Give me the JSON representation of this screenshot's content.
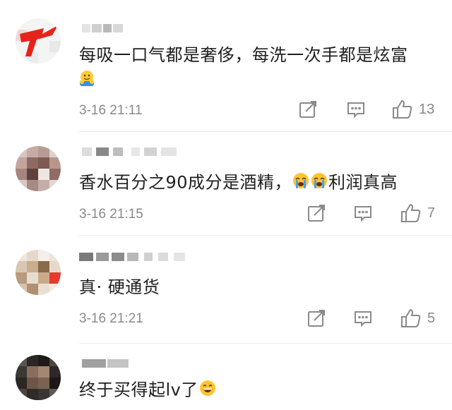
{
  "comments": [
    {
      "text": "每吸一口气都是奢侈，每洗一次手都是炫富",
      "time": "3-16 21:11",
      "likes": "13"
    },
    {
      "text_a": "香水百分之90成分是酒精，",
      "text_b": "利润真高",
      "time": "3-16 21:15",
      "likes": "7"
    },
    {
      "text": "真· 硬通货",
      "time": "3-16 21:21",
      "likes": "5"
    },
    {
      "text": "终于买得起lv了"
    }
  ],
  "icons": {
    "share": "share-icon",
    "comment": "comment-icon",
    "like": "like-icon"
  },
  "colors": {
    "text": "#1f1f1f",
    "meta": "#8a8a8a",
    "divider": "#ececec"
  }
}
